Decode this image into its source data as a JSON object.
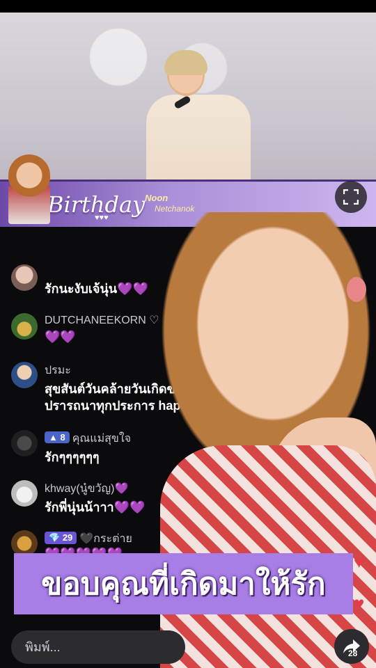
{
  "video": {
    "banner_title": "Birthday",
    "banner_name_line1": "Noon",
    "banner_name_line2": "Netchanok",
    "banner_hearts": "♥♥♥"
  },
  "chat": {
    "messages": [
      {
        "user": "",
        "text": "รักนะงับเจ้นุ่น💜💜"
      },
      {
        "user": "DUTCHANEEKORN ♡",
        "text": "💜💜"
      },
      {
        "user": "ปรมะ",
        "text": "สุขสันต์วันคล้ายวันเกิดขอให้",
        "text2": "ปรารถนาทุกประการ hap"
      },
      {
        "user": "คุณแม่สุขใจ",
        "badge": "8",
        "text": "รักๆๆๆๆๆๆ"
      },
      {
        "user": "khway(นู๋ขวัญ)💜",
        "text": "รักพี่นุ่นน้าาา💜💜"
      },
      {
        "user": "🖤กระต่าย",
        "badge": "29",
        "text": "💜💜💜💜💜"
      }
    ]
  },
  "overlay": {
    "thanks_text": "ขอบคุณที่เกิดมาให้รัก"
  },
  "composer": {
    "placeholder": "พิมพ์..."
  },
  "share": {
    "count": "28"
  }
}
